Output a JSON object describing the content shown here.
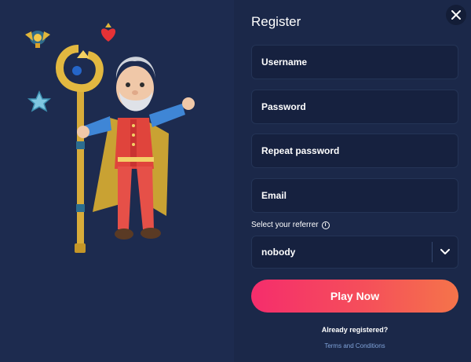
{
  "register": {
    "title": "Register",
    "fields": {
      "username": {
        "placeholder": "Username",
        "value": ""
      },
      "password": {
        "placeholder": "Password",
        "value": ""
      },
      "repeat_password": {
        "placeholder": "Repeat password",
        "value": ""
      },
      "email": {
        "placeholder": "Email",
        "value": ""
      }
    },
    "referrer": {
      "label": "Select your referrer",
      "info_icon": "info-icon",
      "selected": "nobody"
    },
    "play_button": "Play Now",
    "already_registered": "Already registered?",
    "terms_link": "Terms and Conditions"
  },
  "icons": {
    "close": "close-icon",
    "dropdown": "chevron-down-icon"
  },
  "colors": {
    "background_left": "#1d2b4f",
    "background_right": "#1b2849",
    "field_bg": "#16213f",
    "button_gradient_start": "#f52d6c",
    "button_gradient_end": "#f5744a",
    "link": "#7fa2d8"
  }
}
